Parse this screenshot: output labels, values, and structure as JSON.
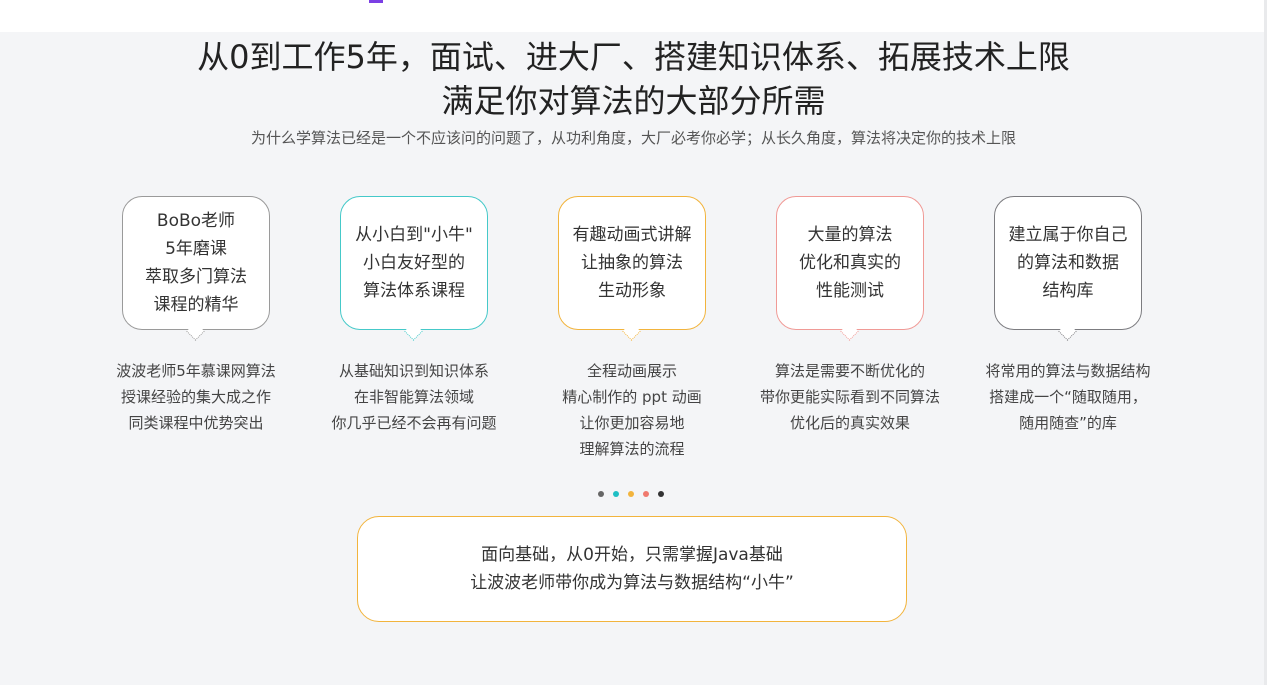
{
  "header": {
    "title_line1": "从0到工作5年，面试、进大厂、搭建知识体系、拓展技术上限",
    "title_line2": "满足你对算法的大部分所需",
    "subtitle": "为什么学算法已经是一个不应该问的问题了，从功利角度，大厂必考你必学；从长久角度，算法将决定你的技术上限"
  },
  "features": [
    {
      "bubble": "BoBo老师\n5年磨课\n萃取多门算法\n课程的精华",
      "desc": "波波老师5年慕课网算法\n授课经验的集大成之作\n同类课程中优势突出",
      "color": "#9a9a9a"
    },
    {
      "bubble": "从小白到\"小牛\"\n小白友好型的\n算法体系课程",
      "desc": "从基础知识到知识体系\n在非智能算法领域\n你几乎已经不会再有问题",
      "color": "#45c9c9"
    },
    {
      "bubble": "有趣动画式讲解\n让抽象的算法\n生动形象",
      "desc": "全程动画展示\n精心制作的 ppt 动画\n让你更加容易地\n理解算法的流程",
      "color": "#f2b43d"
    },
    {
      "bubble": "大量的算法\n优化和真实的\n性能测试",
      "desc": "算法是需要不断优化的\n带你更能实际看到不同算法\n优化后的真实效果",
      "color": "#f09a96"
    },
    {
      "bubble": "建立属于你自己\n的算法和数据\n结构库",
      "desc": "将常用的算法与数据结构\n搭建成一个“随取随用，\n随用随查”的库",
      "color": "#7c7c80"
    }
  ],
  "carousel_dots": [
    "#666666",
    "#1fbfc4",
    "#f2b43d",
    "#f07a6e",
    "#333333"
  ],
  "callout": {
    "line1": "面向基础，从0开始，只需掌握Java基础",
    "line2": "让波波老师带你成为算法与数据结构“小牛”",
    "border_color": "#f2b43d"
  },
  "colors": {
    "background": "#f4f5f7",
    "nav_accent": "#7b3fe4"
  }
}
